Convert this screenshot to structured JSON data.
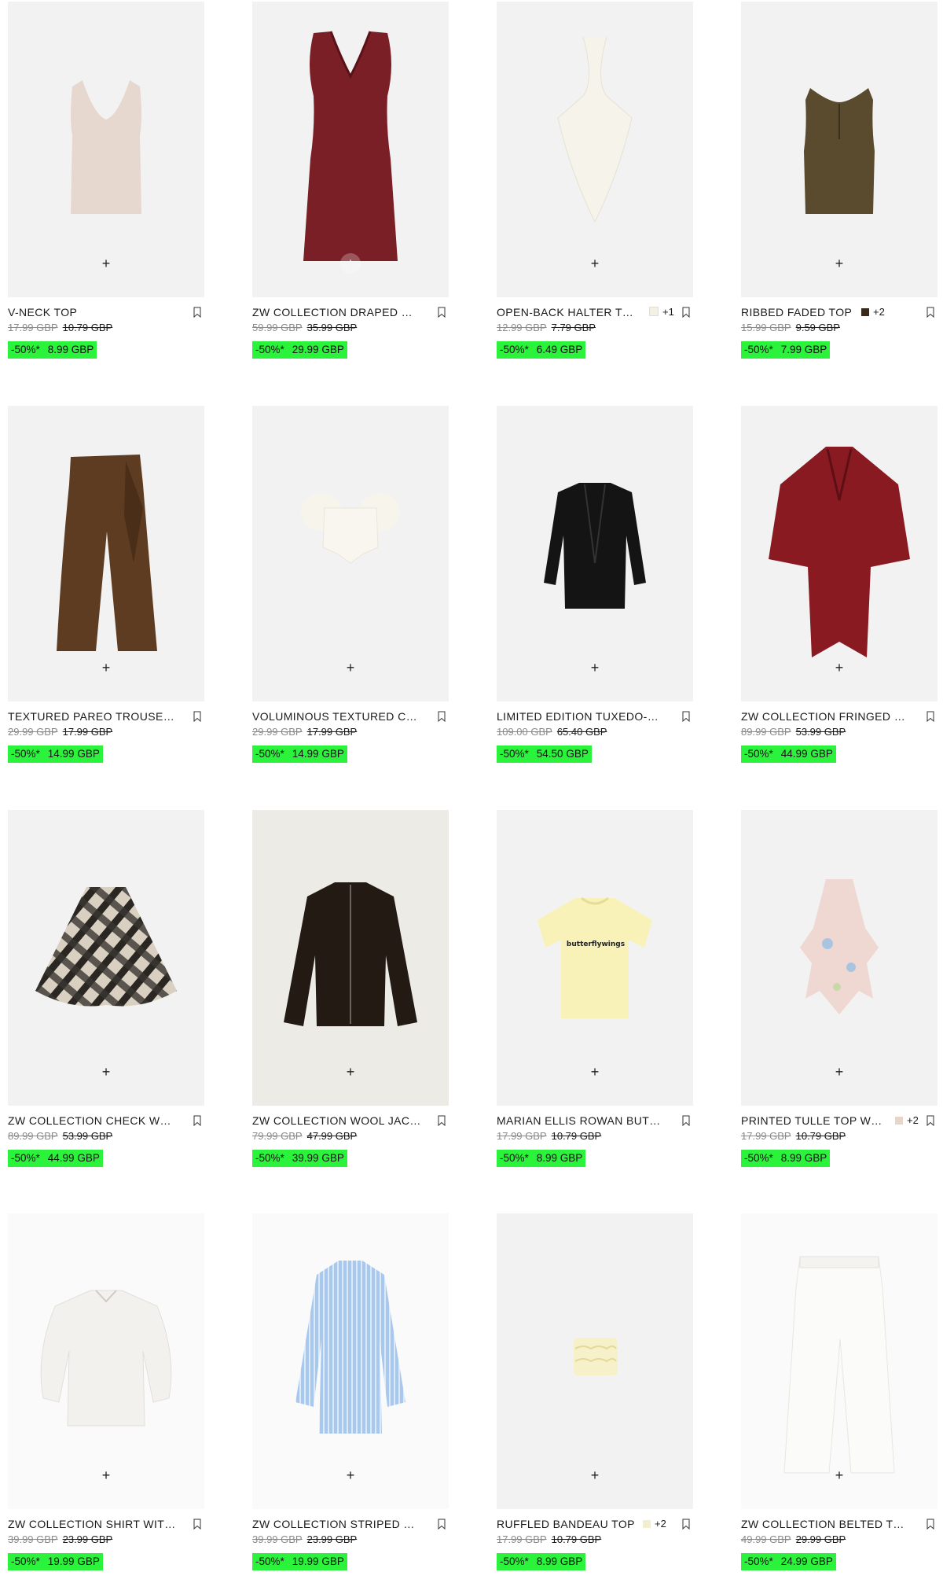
{
  "products": [
    {
      "name": "V-NECK TOP",
      "original_price": "17.99 GBP",
      "previous_price": "10.79 GBP",
      "discount": "-50%*",
      "sale_price": "8.99 GBP",
      "swatch_extra": "",
      "swatch_color": ""
    },
    {
      "name": "ZW COLLECTION DRAPED MIDI DRESS",
      "original_price": "59.99 GBP",
      "previous_price": "35.99 GBP",
      "discount": "-50%*",
      "sale_price": "29.99 GBP",
      "swatch_extra": "",
      "swatch_color": ""
    },
    {
      "name": "OPEN-BACK HALTER TOP",
      "original_price": "12.99 GBP",
      "previous_price": "7.79 GBP",
      "discount": "-50%*",
      "sale_price": "6.49 GBP",
      "swatch_extra": "+1",
      "swatch_color": "#f3f0e6"
    },
    {
      "name": "RIBBED FADED TOP",
      "original_price": "15.99 GBP",
      "previous_price": "9.59 GBP",
      "discount": "-50%*",
      "sale_price": "7.99 GBP",
      "swatch_extra": "+2",
      "swatch_color": "#3a2a1a"
    },
    {
      "name": "TEXTURED PAREO TROUSERS",
      "original_price": "29.99 GBP",
      "previous_price": "17.99 GBP",
      "discount": "-50%*",
      "sale_price": "14.99 GBP",
      "swatch_extra": "",
      "swatch_color": ""
    },
    {
      "name": "VOLUMINOUS TEXTURED CORSET TOP",
      "original_price": "29.99 GBP",
      "previous_price": "17.99 GBP",
      "discount": "-50%*",
      "sale_price": "14.99 GBP",
      "swatch_extra": "",
      "swatch_color": ""
    },
    {
      "name": "LIMITED EDITION TUXEDO-STYLE BLAZER",
      "original_price": "109.00 GBP",
      "previous_price": "65.40 GBP",
      "discount": "-50%*",
      "sale_price": "54.50 GBP",
      "swatch_extra": "",
      "swatch_color": ""
    },
    {
      "name": "ZW COLLECTION FRINGED WOOL PONCHO",
      "original_price": "89.99 GBP",
      "previous_price": "53.99 GBP",
      "discount": "-50%*",
      "sale_price": "44.99 GBP",
      "swatch_extra": "",
      "swatch_color": ""
    },
    {
      "name": "ZW COLLECTION CHECK WOOL CAPE",
      "original_price": "89.99 GBP",
      "previous_price": "53.99 GBP",
      "discount": "-50%*",
      "sale_price": "44.99 GBP",
      "swatch_extra": "",
      "swatch_color": ""
    },
    {
      "name": "ZW COLLECTION WOOL JACKET",
      "original_price": "79.99 GBP",
      "previous_price": "47.99 GBP",
      "discount": "-50%*",
      "sale_price": "39.99 GBP",
      "swatch_extra": "",
      "swatch_color": ""
    },
    {
      "name": "MARIAN ELLIS ROWAN BUTTERFLY T-SHIRT",
      "original_price": "17.99 GBP",
      "previous_price": "10.79 GBP",
      "discount": "-50%*",
      "sale_price": "8.99 GBP",
      "swatch_extra": "",
      "swatch_color": ""
    },
    {
      "name": "PRINTED TULLE TOP WITH RUFFLES",
      "original_price": "17.99 GBP",
      "previous_price": "10.79 GBP",
      "discount": "-50%*",
      "sale_price": "8.99 GBP",
      "swatch_extra": "+2",
      "swatch_color": "#e8d5c8"
    },
    {
      "name": "ZW COLLECTION SHIRT WITH EMBROIDERY",
      "original_price": "39.99 GBP",
      "previous_price": "23.99 GBP",
      "discount": "-50%*",
      "sale_price": "19.99 GBP",
      "swatch_extra": "",
      "swatch_color": ""
    },
    {
      "name": "ZW COLLECTION STRIPED OVERSIZE SHIRT",
      "original_price": "39.99 GBP",
      "previous_price": "23.99 GBP",
      "discount": "-50%*",
      "sale_price": "19.99 GBP",
      "swatch_extra": "",
      "swatch_color": ""
    },
    {
      "name": "RUFFLED BANDEAU TOP",
      "original_price": "17.99 GBP",
      "previous_price": "10.79 GBP",
      "discount": "-50%*",
      "sale_price": "8.99 GBP",
      "swatch_extra": "+2",
      "swatch_color": "#f1efd0"
    },
    {
      "name": "ZW COLLECTION BELTED TROUSERS",
      "original_price": "49.99 GBP",
      "previous_price": "29.99 GBP",
      "discount": "-50%*",
      "sale_price": "24.99 GBP",
      "swatch_extra": "",
      "swatch_color": ""
    }
  ],
  "tshirt_print": "butterflywings",
  "sale_highlight_color": "#2bf23a",
  "icons": {
    "add": "plus-icon",
    "save": "bookmark-icon"
  }
}
